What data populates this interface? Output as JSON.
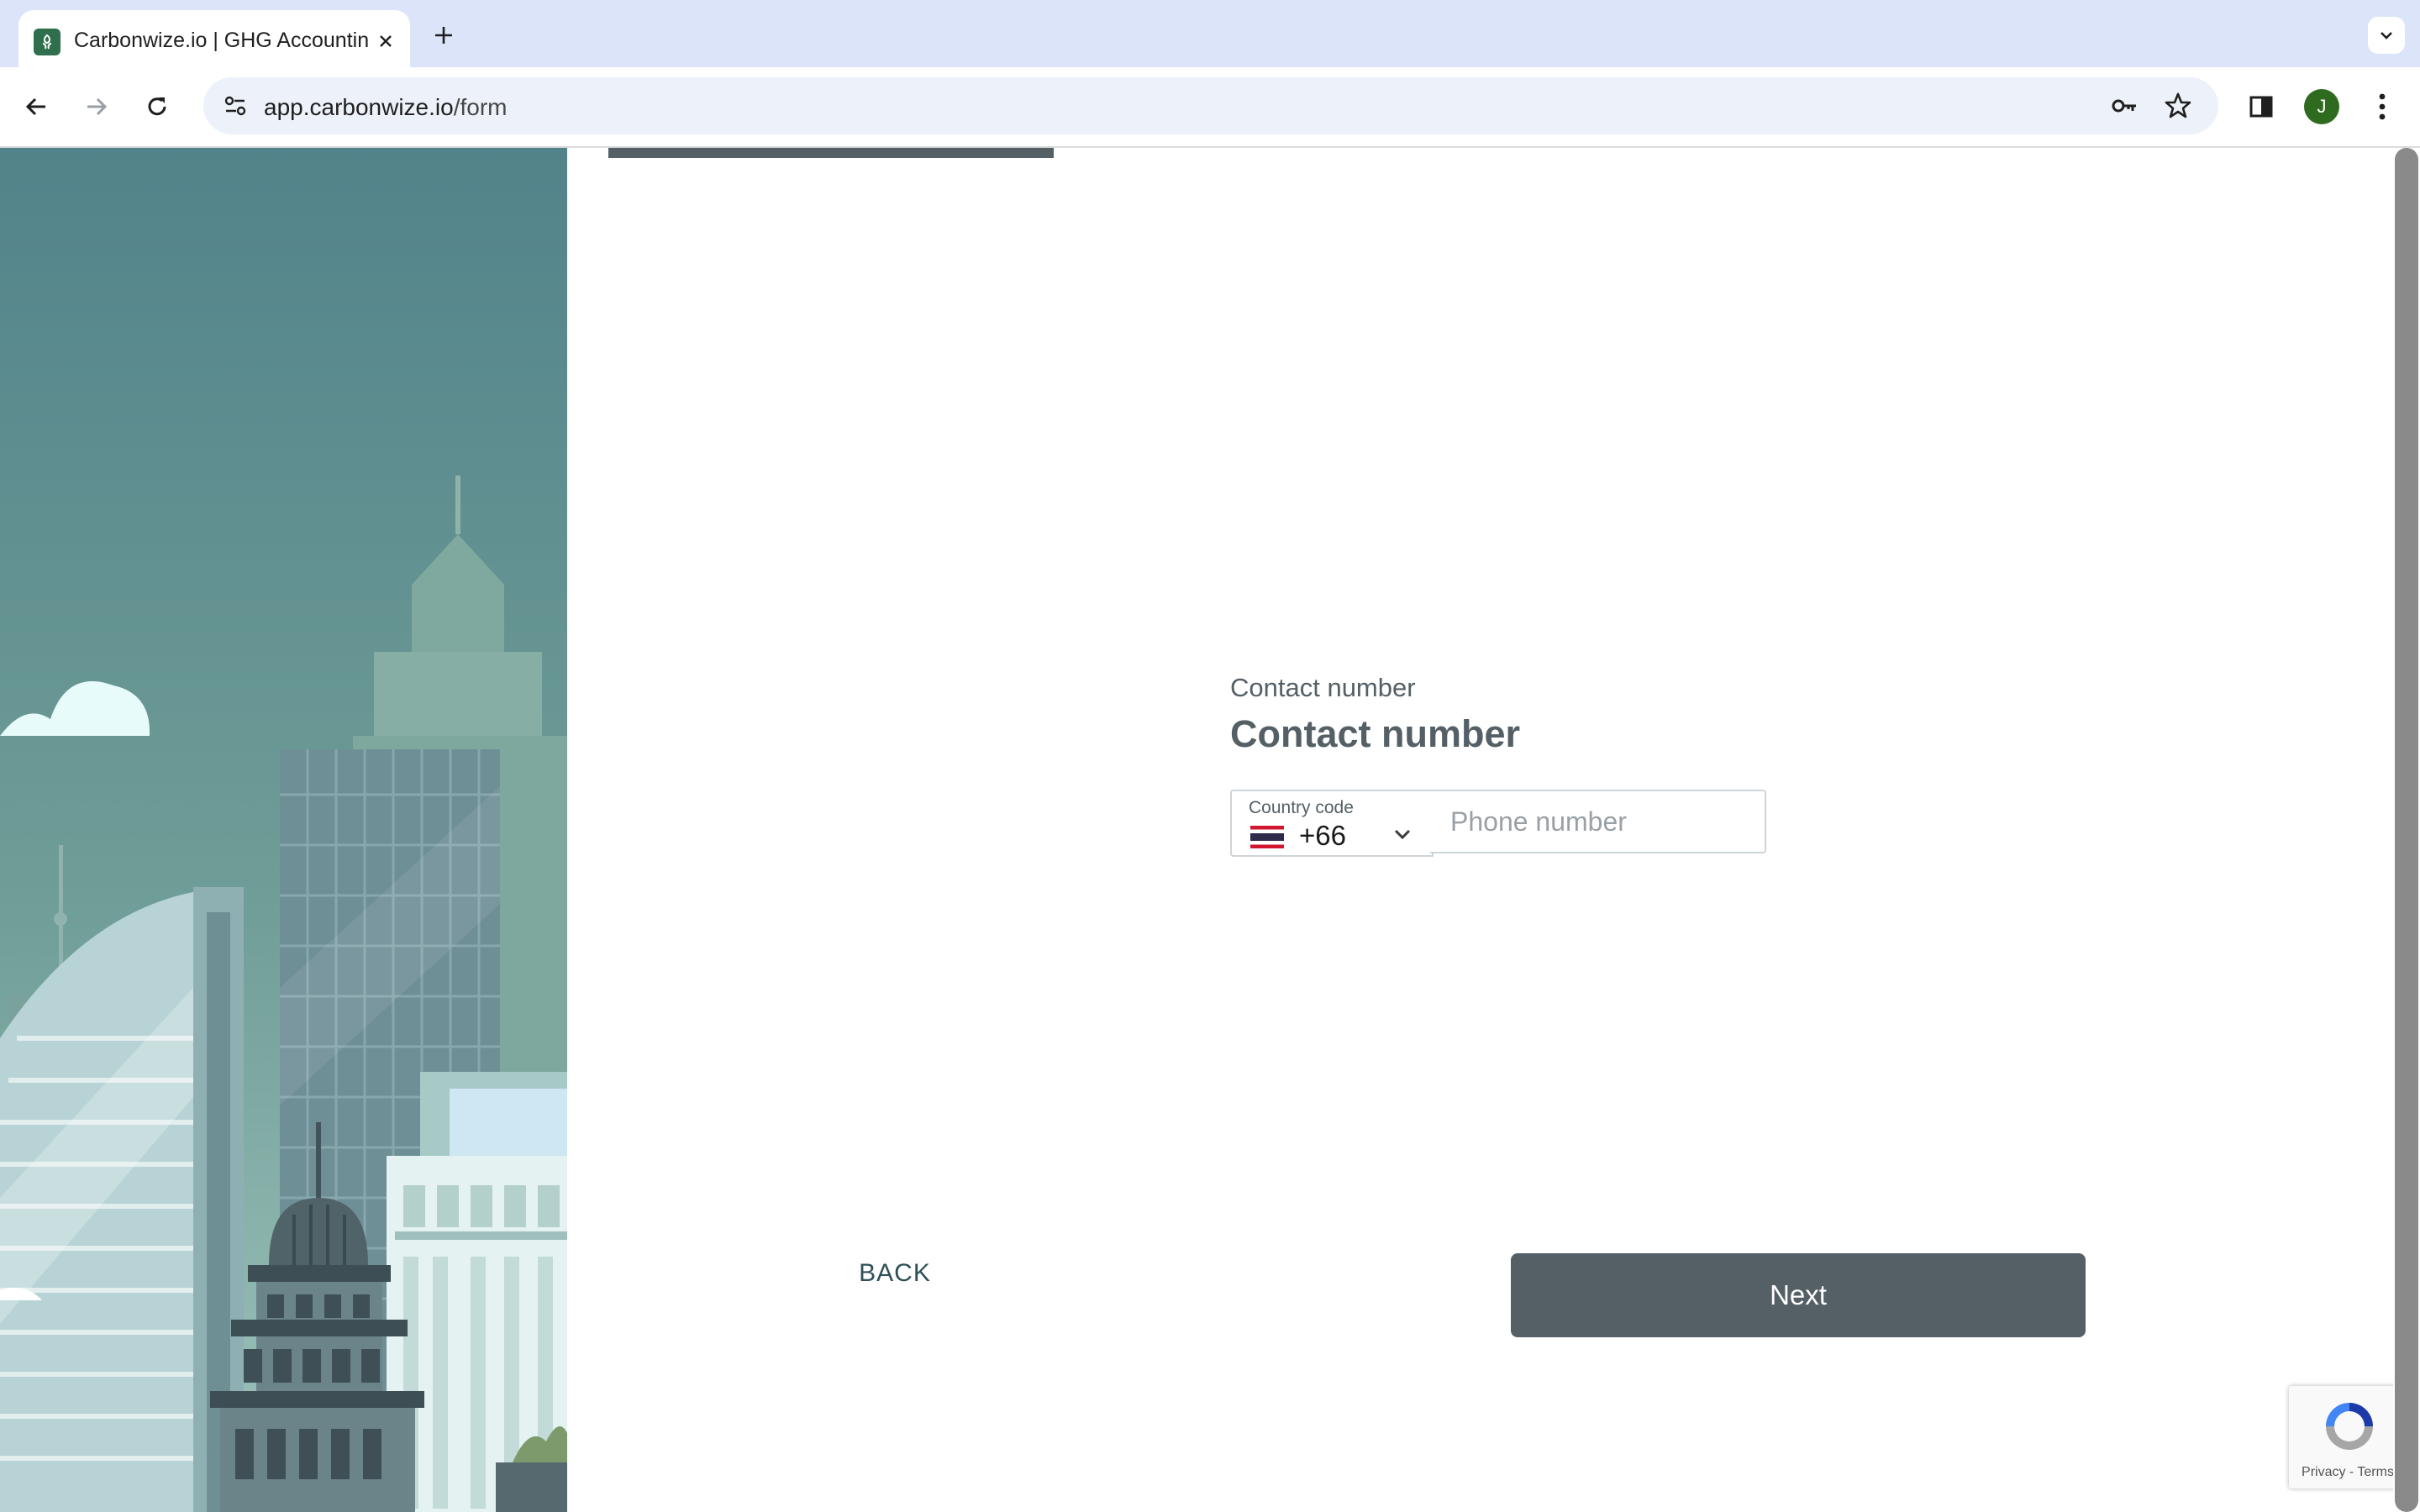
{
  "browser": {
    "tab": {
      "title": "Carbonwize.io | GHG Accounting"
    },
    "url": {
      "domain": "app.carbonwize.io",
      "path": "/form"
    },
    "profile_initial": "J",
    "icons": [
      "back-arrow-icon",
      "forward-arrow-icon",
      "reload-icon",
      "site-info-icon",
      "key-icon",
      "star-icon",
      "side-panel-icon",
      "kebab-menu-icon",
      "new-tab-plus-icon",
      "tab-search-chevron-icon",
      "tab-close-icon"
    ]
  },
  "form": {
    "progress_fraction": 0.33,
    "question_label": "Contact number",
    "question_title": "Contact number",
    "country_code": {
      "label": "Country code",
      "value": "+66",
      "flag": "thailand-flag-icon"
    },
    "phone": {
      "placeholder": "Phone number",
      "value": ""
    },
    "back_label": "BACK",
    "next_label": "Next"
  },
  "recaptcha": {
    "privacy": "Privacy",
    "separator": " - ",
    "terms": "Terms"
  },
  "colors": {
    "accent": "#545f66",
    "tabbar": "#dbe4f9",
    "omnibox": "#edf1f9",
    "sky": "#5a8a8e"
  }
}
